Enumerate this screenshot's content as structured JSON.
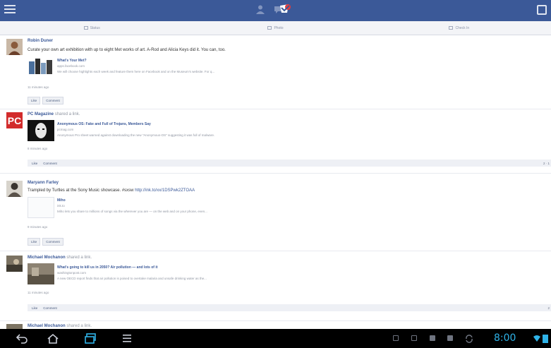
{
  "colors": {
    "brand": "#3b5998",
    "clock": "#2fb3e8"
  },
  "topbar": {
    "icons": [
      "menu-icon",
      "friend-requests-icon",
      "messages-icon",
      "notifications-icon",
      "chat-icon"
    ]
  },
  "actions": [
    {
      "icon": "status-icon",
      "label": "Status"
    },
    {
      "icon": "photo-icon",
      "label": "Photo"
    },
    {
      "icon": "check-in-icon",
      "label": "Check In"
    }
  ],
  "posts": [
    {
      "name": "Robin Duner",
      "shared": "",
      "message": "Curate your own art exhibition with up to eight Met works of art. A-Rod and Alicia Keys did it. You can, too.",
      "link_title": "What's Your Met?",
      "link_domain": "apps.facebook.com",
      "link_desc": "We will choose highlights each week and feature them here on Facebook and on the Museum's website. For q...",
      "time": "11 minutes ago",
      "like": "Like",
      "comment": "Comment"
    },
    {
      "name": "PC Magazine",
      "shared": "shared a link.",
      "message": "",
      "link_title": "Anonymous OS: Fake and Full of Trojans, Members Say",
      "link_domain": "pcmag.com",
      "link_desc": "Anonymous Pro sheet warned against downloading the new \"Anonymous-OS\" suggesting it was full of malware.",
      "time": "8 minutes ago",
      "like": "Like",
      "comment": "Comment",
      "counts": "2 · 1"
    },
    {
      "name": "Maryann Farley",
      "shared": "",
      "message": "Trampled by Turtles at the Sony Music showcase. #sxsw",
      "message_link": "http://ink.to/xx/1DSPwk2ZTOAA",
      "link_title": "Miho",
      "link_domain": "ink.to",
      "link_desc": "Miho lets you share to millions of songs via the wherever you are — on the web and on your phone, even...",
      "time": "9 minutes ago",
      "like": "Like",
      "comment": "Comment"
    },
    {
      "name": "Michael Mochanon",
      "shared": "shared a link.",
      "message": "",
      "link_title": "What's going to kill us in 2050? Air pollution — and lots of it",
      "link_domain": "washingtonpost.com",
      "link_desc": "A new OECD report finds that air pollution is poised to overtake malaria and unsafe drinking water as the...",
      "time": "11 minutes ago",
      "like": "Like",
      "comment": "Comment",
      "counts": "2"
    }
  ],
  "next_post": {
    "name": "Michael Mochanon",
    "shared": "shared a link."
  },
  "navbar": {
    "buttons": [
      "back-icon",
      "home-icon",
      "recent-apps-icon",
      "menu-icon"
    ],
    "clock": "8:00"
  }
}
